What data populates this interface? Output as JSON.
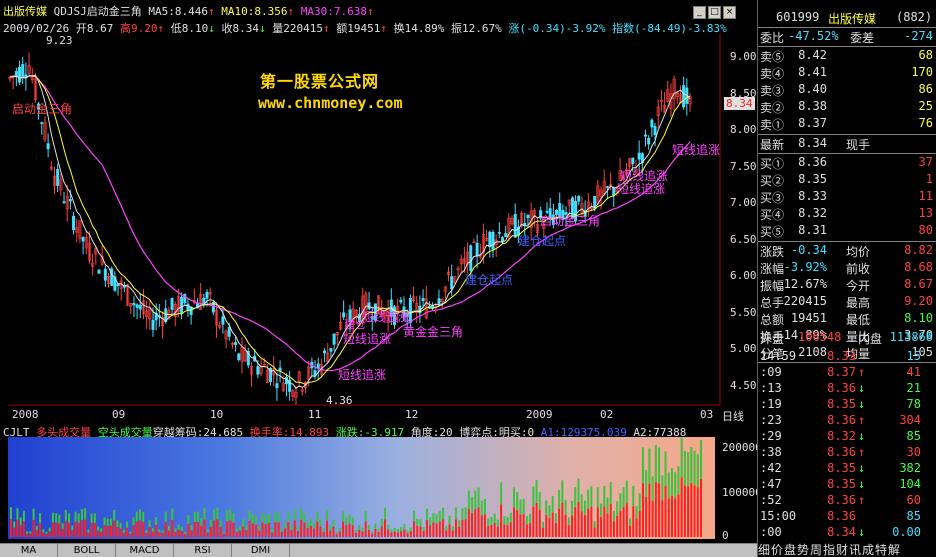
{
  "header": {
    "name": "出版传媒",
    "formula": "QDJSJ启动金三角",
    "ma5": "MA5:8.446",
    "ma10": "MA10:8.356",
    "ma30": "MA30:7.638"
  },
  "bar_info": {
    "date": "2009/02/26",
    "open": "开8.67",
    "high": "高9.20",
    "low": "低8.10",
    "close": "收8.34",
    "vol": "量220415",
    "amt": "额19451",
    "turnover": "换14.89%",
    "amplitude": "振12.67%",
    "change": "涨(-0.34)-3.92%",
    "index": "指数(-84.49)-3.83%"
  },
  "watermark": {
    "line1": "第一股票公式网",
    "line2": "www.chnmoney.com"
  },
  "price_axis": [
    "9.00",
    "8.50",
    "8.00",
    "7.50",
    "7.00",
    "6.50",
    "6.00",
    "5.50",
    "5.00",
    "4.50"
  ],
  "last_price_tag": "8.34",
  "hi_label": "9.23",
  "lo_label": "4.36",
  "chart_labels": [
    {
      "text": "启动金三角",
      "color": "#ff4040"
    },
    {
      "text": "短线追涨",
      "color": "#ff40ff"
    },
    {
      "text": "短线追涨",
      "color": "#ff40ff"
    },
    {
      "text": "短线追涨",
      "color": "#ff40ff"
    },
    {
      "text": "建仓",
      "color": "#ff40ff"
    },
    {
      "text": "黄金金三角",
      "color": "#ff40ff"
    },
    {
      "text": "建仓起点",
      "color": "#4060ff"
    },
    {
      "text": "建仓起点",
      "color": "#4060ff"
    },
    {
      "text": "启动金三角",
      "color": "#ff40ff"
    },
    {
      "text": "短线追涨",
      "color": "#ff40ff"
    },
    {
      "text": "短线追涨",
      "color": "#ff40ff"
    },
    {
      "text": "短线追涨",
      "color": "#ff40ff"
    }
  ],
  "date_axis": [
    "2008",
    "09",
    "10",
    "11",
    "12",
    "2009",
    "02",
    "03"
  ],
  "date_axis_label": "日线",
  "indicator": {
    "name": "CJLT",
    "a": "多头成交量",
    "b": "空头成交量",
    "c": "穿越筹码:24.685",
    "d": "换手率:14.893",
    "e": "涨跌:-3.917",
    "f": "角度:20",
    "g": "博弈点:明买:0",
    "h": "A1:129375.039",
    "i": "A2:77388"
  },
  "vol_axis": [
    "200000",
    "100000",
    "0"
  ],
  "tabs": [
    "MA",
    "BOLL",
    "MACD",
    "RSI",
    "DMI"
  ],
  "panel": {
    "code": "601999",
    "name": "出版传媒",
    "num": "(882)",
    "wb_label": "委比",
    "wb_val": "-47.52%",
    "wc_label": "委差",
    "wc_val": "-274",
    "sell": [
      {
        "l": "卖⑤",
        "p": "8.42",
        "v": "68"
      },
      {
        "l": "卖④",
        "p": "8.41",
        "v": "170"
      },
      {
        "l": "卖③",
        "p": "8.40",
        "v": "86"
      },
      {
        "l": "卖②",
        "p": "8.38",
        "v": "25"
      },
      {
        "l": "卖①",
        "p": "8.37",
        "v": "76"
      }
    ],
    "last_label": "最新",
    "last_price": "8.34",
    "now_label": "现手",
    "buy": [
      {
        "l": "买①",
        "p": "8.36",
        "v": "37"
      },
      {
        "l": "买②",
        "p": "8.35",
        "v": "1"
      },
      {
        "l": "买③",
        "p": "8.33",
        "v": "11"
      },
      {
        "l": "买④",
        "p": "8.32",
        "v": "13"
      },
      {
        "l": "买⑤",
        "p": "8.31",
        "v": "80"
      }
    ],
    "stats": [
      {
        "a": "涨跌",
        "b": "-0.34",
        "c": "均价",
        "d": "8.82"
      },
      {
        "a": "涨幅",
        "b": "-3.92%",
        "c": "前收",
        "d": "8.68"
      },
      {
        "a": "振幅",
        "b": "12.67%",
        "c": "今开",
        "d": "8.67"
      },
      {
        "a": "总手",
        "b": "220415",
        "c": "最高",
        "d": "9.20"
      },
      {
        "a": "总额",
        "b": "19451",
        "c": "最低",
        "d": "8.10"
      },
      {
        "a": "换手",
        "b": "14.89%",
        "c": "量比",
        "d": "3.70"
      },
      {
        "a": "分笔",
        "b": "2108",
        "c": "均量",
        "d": "105"
      }
    ],
    "outer_label": "外盘",
    "outer_val": "106548",
    "inner_label": "内盘",
    "inner_val": "113868",
    "ticks": [
      {
        "t": "14:59",
        "p": "8.33",
        "a": "",
        "v": "15",
        "c": "#40e0ff"
      },
      {
        "t": ":09",
        "p": "8.37",
        "a": "↑",
        "v": "41",
        "c": "#ff4040"
      },
      {
        "t": ":13",
        "p": "8.36",
        "a": "↓",
        "v": "21",
        "c": "#40ff40"
      },
      {
        "t": ":19",
        "p": "8.35",
        "a": "↓",
        "v": "78",
        "c": "#40ff40"
      },
      {
        "t": ":23",
        "p": "8.36",
        "a": "↑",
        "v": "304",
        "c": "#ff4040"
      },
      {
        "t": ":29",
        "p": "8.32",
        "a": "↓",
        "v": "85",
        "c": "#40ff40"
      },
      {
        "t": ":38",
        "p": "8.36",
        "a": "↑",
        "v": "30",
        "c": "#ff4040"
      },
      {
        "t": ":42",
        "p": "8.35",
        "a": "↓",
        "v": "382",
        "c": "#40ff40"
      },
      {
        "t": ":47",
        "p": "8.35",
        "a": "↓",
        "v": "104",
        "c": "#40ff40"
      },
      {
        "t": ":52",
        "p": "8.36",
        "a": "↑",
        "v": "60",
        "c": "#ff4040"
      },
      {
        "t": "15:00",
        "p": "8.36",
        "a": "",
        "v": "85",
        "c": "#40e0ff"
      },
      {
        "t": ":00",
        "p": "8.34",
        "a": "↓",
        "v": "0.00",
        "c": "#40e0ff"
      }
    ],
    "bottom_tabs": "细价盘势周指财讯成特解"
  },
  "colors": {
    "up": "#ff4040",
    "down": "#40e0ff",
    "ma5": "#e0e0e0",
    "ma10": "#ffff40",
    "ma30": "#ff40ff",
    "bg": "#000000"
  }
}
